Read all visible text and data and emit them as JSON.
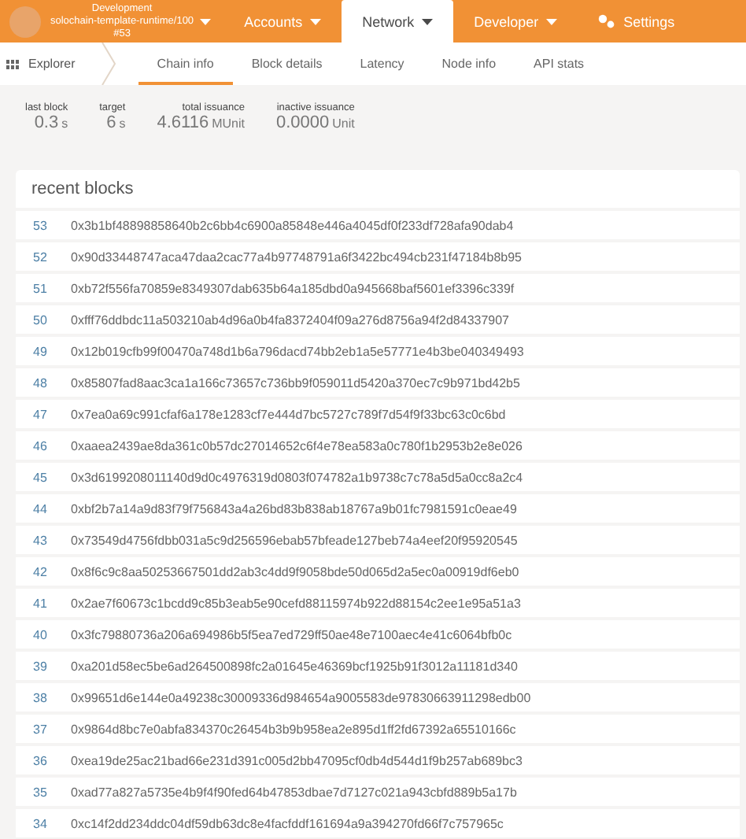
{
  "header": {
    "chain": {
      "line_1": "Development",
      "line_2": "solochain-template-runtime/100",
      "line_3": "#53"
    },
    "menu": [
      {
        "label": "Accounts",
        "kind": "dropdown",
        "selected": false
      },
      {
        "label": "Network",
        "kind": "dropdown",
        "selected": true
      },
      {
        "label": "Developer",
        "kind": "dropdown",
        "selected": false
      },
      {
        "label": "Settings",
        "kind": "settings",
        "selected": false
      }
    ]
  },
  "subnav": {
    "section": "Explorer",
    "tabs": [
      {
        "label": "Chain info",
        "selected": true
      },
      {
        "label": "Block details",
        "selected": false
      },
      {
        "label": "Latency",
        "selected": false
      },
      {
        "label": "Node info",
        "selected": false
      },
      {
        "label": "API stats",
        "selected": false
      }
    ]
  },
  "stats": [
    {
      "label": "last block",
      "value": "0.3",
      "unit": "s"
    },
    {
      "label": "target",
      "value": "6",
      "unit": "s"
    },
    {
      "label": "total issuance",
      "value": "4.6116",
      "unit": "MUnit"
    },
    {
      "label": "inactive issuance",
      "value": "0.0000",
      "unit": "Unit"
    }
  ],
  "recent_blocks": {
    "title": "recent blocks",
    "rows": [
      {
        "number": "53",
        "hash": "0x3b1bf48898858640b2c6bb4c6900a85848e446a4045df0f233df728afa90dab4"
      },
      {
        "number": "52",
        "hash": "0x90d33448747aca47daa2cac77a4b97748791a6f3422bc494cb231f47184b8b95"
      },
      {
        "number": "51",
        "hash": "0xb72f556fa70859e8349307dab635b64a185dbd0a945668baf5601ef3396c339f"
      },
      {
        "number": "50",
        "hash": "0xfff76ddbdc11a503210ab4d96a0b4fa8372404f09a276d8756a94f2d84337907"
      },
      {
        "number": "49",
        "hash": "0x12b019cfb99f00470a748d1b6a796dacd74bb2eb1a5e57771e4b3be040349493"
      },
      {
        "number": "48",
        "hash": "0x85807fad8aac3ca1a166c73657c736bb9f059011d5420a370ec7c9b971bd42b5"
      },
      {
        "number": "47",
        "hash": "0x7ea0a69c991cfaf6a178e1283cf7e444d7bc5727c789f7d54f9f33bc63c0c6bd"
      },
      {
        "number": "46",
        "hash": "0xaaea2439ae8da361c0b57dc27014652c6f4e78ea583a0c780f1b2953b2e8e026"
      },
      {
        "number": "45",
        "hash": "0x3d6199208011140d9d0c4976319d0803f074782a1b9738c7c78a5d5a0cc8a2c4"
      },
      {
        "number": "44",
        "hash": "0xbf2b7a14a9d83f79f756843a4a26bd83b838ab18767a9b01fc7981591c0eae49"
      },
      {
        "number": "43",
        "hash": "0x73549d4756fdbb031a5c9d256596ebab57bfeade127beb74a4eef20f95920545"
      },
      {
        "number": "42",
        "hash": "0x8f6c9c8aa50253667501dd2ab3c4dd9f9058bde50d065d2a5ec0a00919df6eb0"
      },
      {
        "number": "41",
        "hash": "0x2ae7f60673c1bcdd9c85b3eab5e90cefd88115974b922d88154c2ee1e95a51a3"
      },
      {
        "number": "40",
        "hash": "0x3fc79880736a206a694986b5f5ea7ed729ff50ae48e7100aec4e41c6064bfb0c"
      },
      {
        "number": "39",
        "hash": "0xa201d58ec5be6ad264500898fc2a01645e46369bcf1925b91f3012a11181d340"
      },
      {
        "number": "38",
        "hash": "0x99651d6e144e0a49238c30009336d984654a9005583de97830663911298edb00"
      },
      {
        "number": "37",
        "hash": "0x9864d8bc7e0abfa834370c26454b3b9b958ea2e895d1ff2fd67392a65510166c"
      },
      {
        "number": "36",
        "hash": "0xea19de25ac21bad66e231d391c005d2bb47095cf0db4d544d1f9b257ab689bc3"
      },
      {
        "number": "35",
        "hash": "0xad77a827a5735e4b9f4f90fed64b47853dbae7d7127c021a943cbfd889b5a17b"
      },
      {
        "number": "34",
        "hash": "0xc14f2dd234ddc04df59db63dc8e4facfddf161694a9a394270fd66f7c757965c"
      }
    ]
  }
}
